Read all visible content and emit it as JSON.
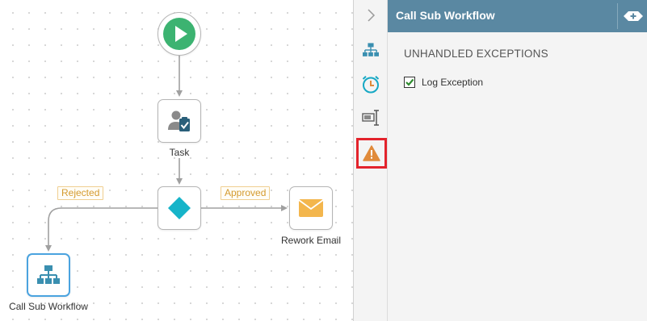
{
  "canvas": {
    "nodes": {
      "start": {
        "icon": "play-icon"
      },
      "task": {
        "label": "Task",
        "icon": "user-task-icon"
      },
      "decision": {
        "icon": "diamond-icon"
      },
      "rework_email": {
        "label": "Rework Email",
        "icon": "envelope-icon"
      },
      "call_sub_workflow": {
        "label": "Call Sub Workflow",
        "icon": "hierarchy-icon"
      }
    },
    "edges": {
      "rejected_label": "Rejected",
      "approved_label": "Approved"
    }
  },
  "side_strip": {
    "items": [
      {
        "name": "expand",
        "icon": "chevron-right-icon"
      },
      {
        "name": "workflow",
        "icon": "hierarchy-icon"
      },
      {
        "name": "timer",
        "icon": "stopwatch-icon"
      },
      {
        "name": "text-input",
        "icon": "text-cursor-icon"
      },
      {
        "name": "exceptions",
        "icon": "warning-icon",
        "active": true
      }
    ]
  },
  "panel": {
    "title": "Call Sub Workflow",
    "add_icon": "add-icon",
    "section_title": "UNHANDLED EXCEPTIONS",
    "log_exception": {
      "label": "Log Exception",
      "checked": true
    }
  },
  "colors": {
    "header": "#5a88a2",
    "play_green": "#3cb371",
    "accent_teal": "#16b4c9",
    "email_yellow": "#f3b64d",
    "warning_orange": "#e08a3a",
    "highlight_red": "#e3232c",
    "edge_label_orange": "#d49a2e"
  }
}
